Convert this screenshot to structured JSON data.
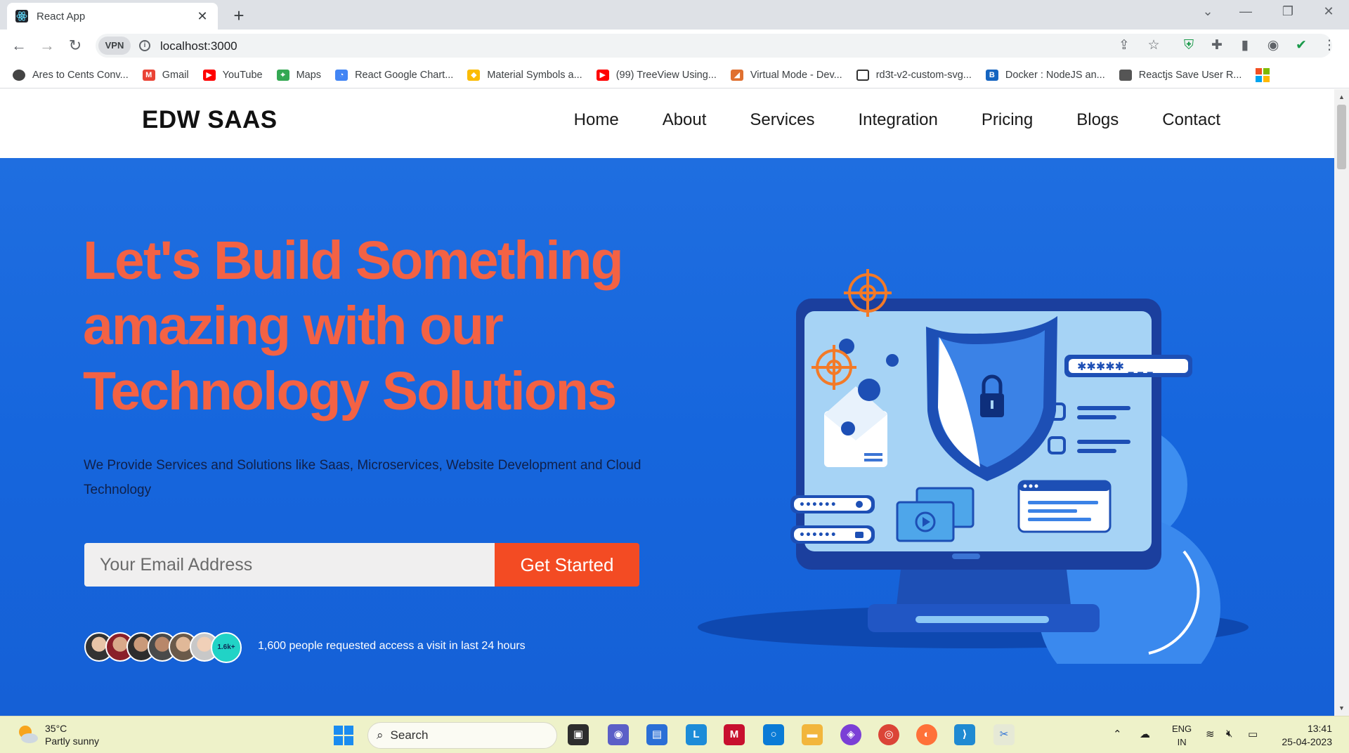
{
  "browser": {
    "tab_title": "React App",
    "tab_close": "✕",
    "new_tab": "+",
    "url": "localhost:3000",
    "vpn_label": "VPN",
    "bookmarks": [
      {
        "label": "Ares to Cents Conv...",
        "color": "#444"
      },
      {
        "label": "Gmail",
        "color": "#ea4335"
      },
      {
        "label": "YouTube",
        "color": "#ff0000"
      },
      {
        "label": "Maps",
        "color": "#34a853"
      },
      {
        "label": "React Google Chart...",
        "color": "#4285f4"
      },
      {
        "label": "Material Symbols a...",
        "color": "#fbbc05"
      },
      {
        "label": "(99) TreeView Using...",
        "color": "#ff0000"
      },
      {
        "label": "Virtual Mode - Dev...",
        "color": "#333"
      },
      {
        "label": "rd3t-v2-custom-svg...",
        "color": "#fff"
      },
      {
        "label": "Docker : NodeJS an...",
        "color": "#1565c0"
      },
      {
        "label": "Reactjs Save User R...",
        "color": "#555"
      }
    ]
  },
  "site": {
    "logo": "EDW SAAS",
    "nav": [
      "Home",
      "About",
      "Services",
      "Integration",
      "Pricing",
      "Blogs",
      "Contact"
    ],
    "hero": {
      "title_lines": [
        "Let's Build Something",
        "amazing with our",
        "Technology Solutions"
      ],
      "subtitle": "We Provide Services and Solutions like Saas, Microservices, Website Development and Cloud Technology",
      "email_placeholder": "Your Email Address",
      "cta": "Get Started",
      "avatar_count": "1.6k+",
      "access_text": "1,600 people requested access a visit in last 24 hours"
    },
    "colors": {
      "hero_bg": "#1666dd",
      "title": "#f36244",
      "cta": "#f34b23"
    }
  },
  "taskbar": {
    "temperature": "35°C",
    "weather": "Partly sunny",
    "search": "Search",
    "language": "ENG",
    "region": "IN",
    "time": "13:41",
    "date": "25-04-2023"
  }
}
